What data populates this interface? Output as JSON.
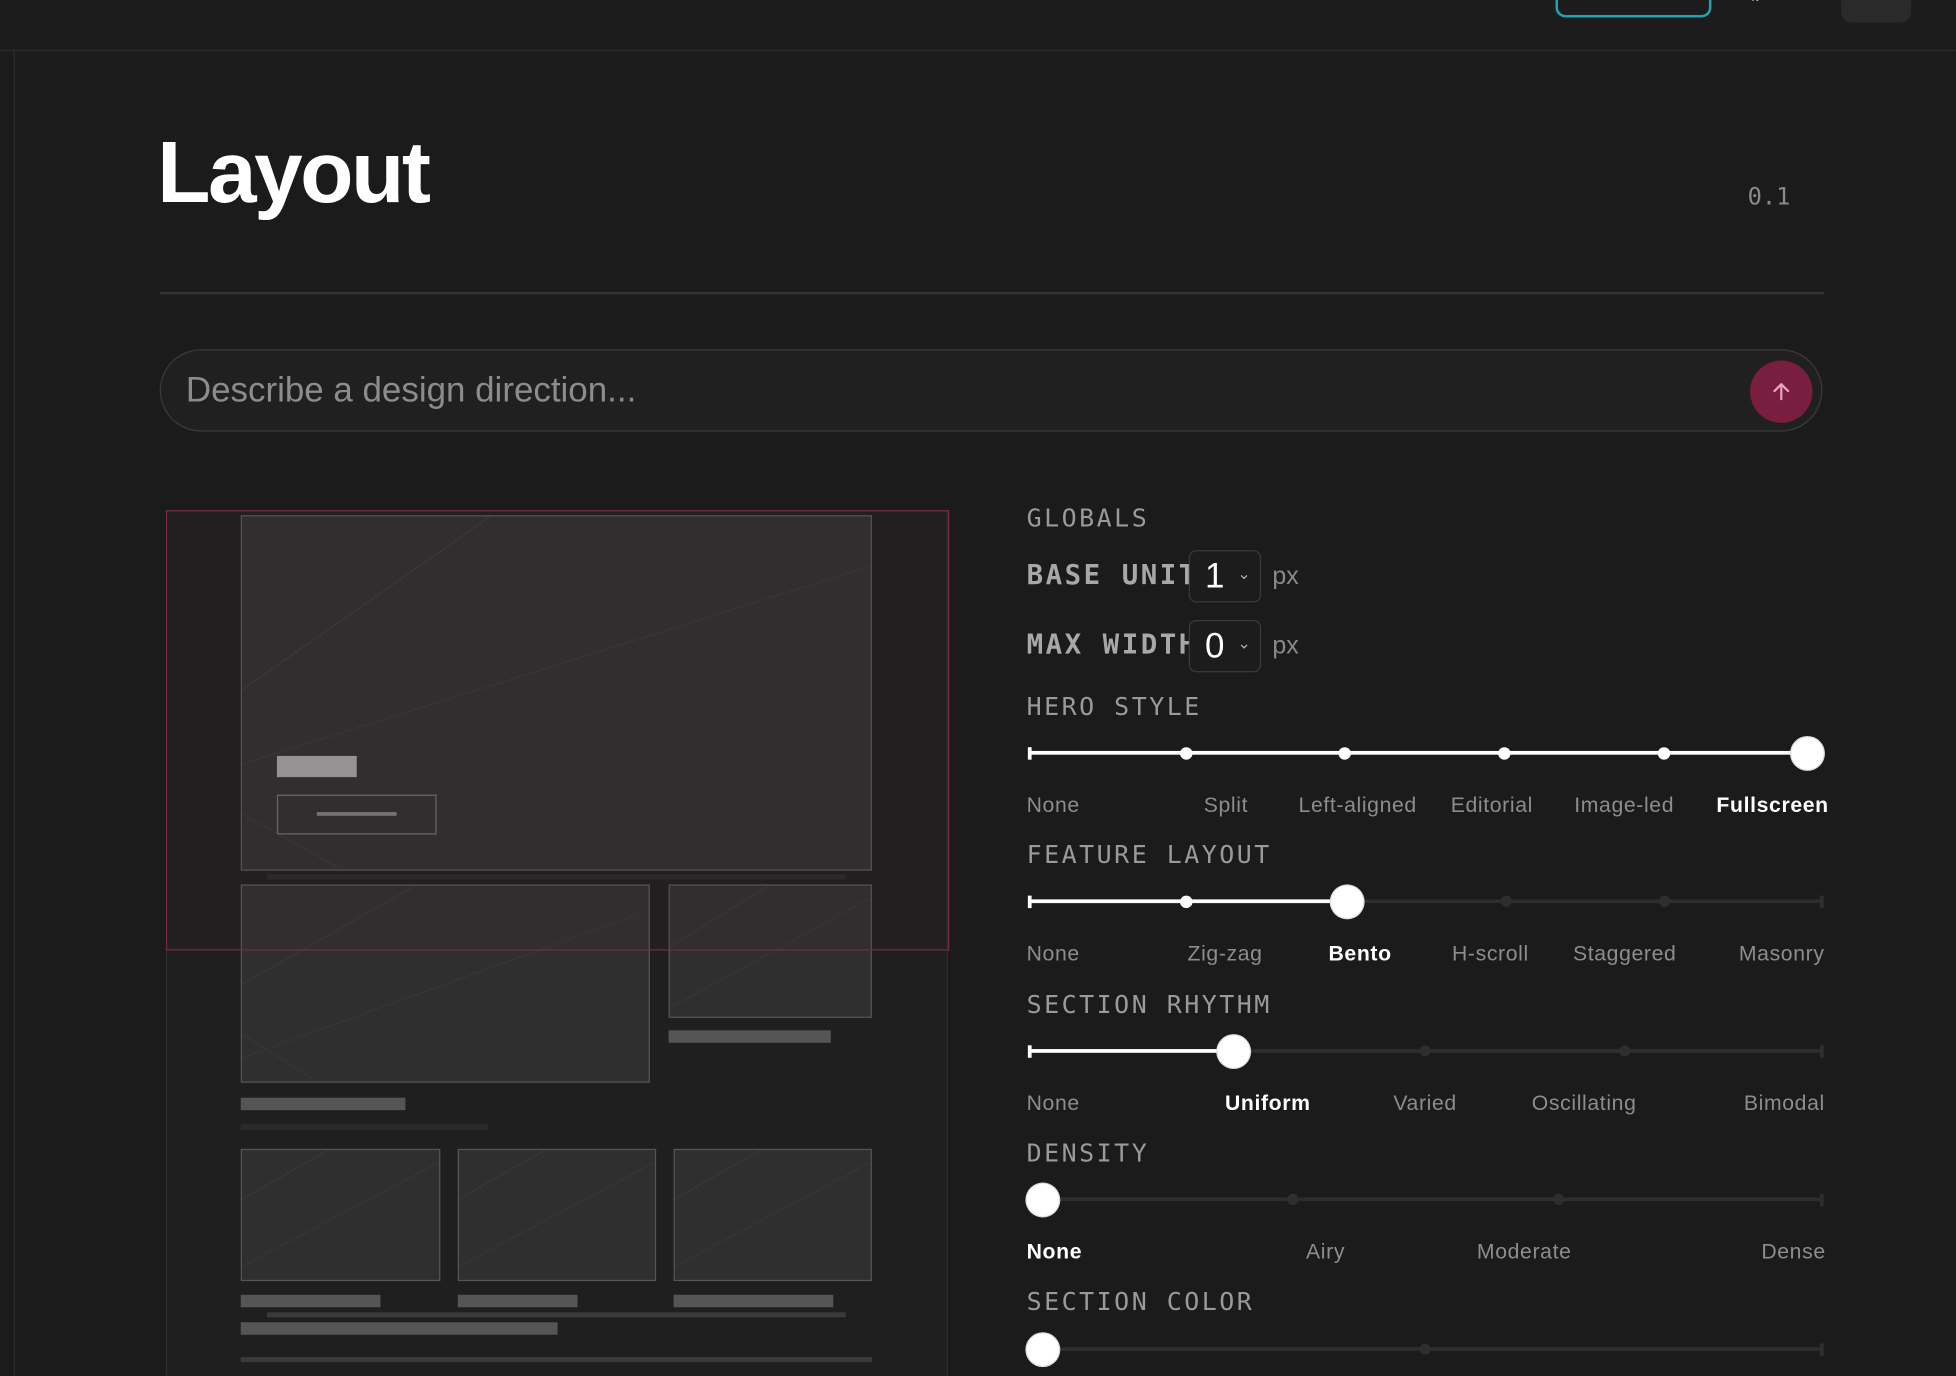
{
  "page": {
    "title": "Layout",
    "version": "0.1"
  },
  "prompt": {
    "placeholder": "Describe a design direction..."
  },
  "controls": {
    "globals_heading": "GLOBALS",
    "base_unit": {
      "label": "BASE UNIT",
      "value": "1",
      "unit": "px"
    },
    "max_width": {
      "label": "MAX WIDTH",
      "value": "0",
      "unit": "px"
    },
    "hero_style": {
      "label": "HERO STYLE",
      "options": [
        "None",
        "Split",
        "Left-aligned",
        "Editorial",
        "Image-led",
        "Fullscreen"
      ],
      "selected": "Fullscreen"
    },
    "feature_layout": {
      "label": "FEATURE LAYOUT",
      "options": [
        "None",
        "Zig-zag",
        "Bento",
        "H-scroll",
        "Staggered",
        "Masonry"
      ],
      "selected": "Bento"
    },
    "section_rhythm": {
      "label": "SECTION RHYTHM",
      "options": [
        "None",
        "Uniform",
        "Varied",
        "Oscillating",
        "Bimodal"
      ],
      "selected": "Uniform"
    },
    "density": {
      "label": "DENSITY",
      "options": [
        "None",
        "Airy",
        "Moderate",
        "Dense"
      ],
      "selected": "None"
    },
    "section_color": {
      "label": "SECTION COLOR"
    }
  },
  "colors": {
    "accent_send": "#7a1e40",
    "viewport_outline": "#7a2a45",
    "top_button_outline": "#1fa3b5"
  }
}
